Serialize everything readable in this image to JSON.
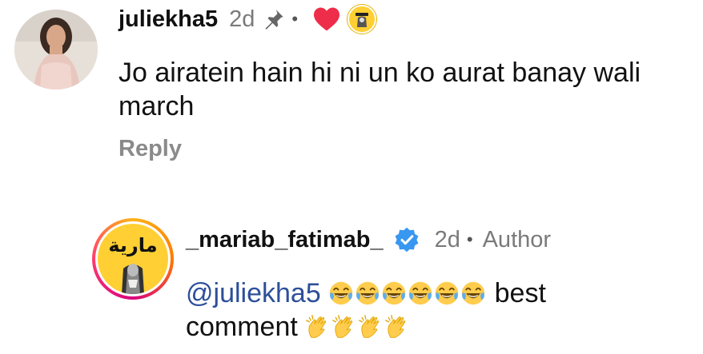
{
  "comments": [
    {
      "username": "juliekha5",
      "age": "2d",
      "body": "Jo airatein hain hi ni un ko aurat banay wali march",
      "reply_label": "Reply",
      "icons": [
        "pin-icon",
        "heart-icon",
        "creator-liked-badge"
      ]
    },
    {
      "username": "_mariab_fatimab_",
      "age": "2d",
      "author_label": "Author",
      "mention": "@juliekha5",
      "text_after_laugh": "best",
      "text_line2": "comment",
      "avatar_text": "مارية",
      "icons": [
        "verified-icon",
        "laughing-emoji",
        "clapping-emoji"
      ]
    }
  ],
  "colors": {
    "username": "#111111",
    "meta": "#7a7a7a",
    "mention": "#2d4f9a",
    "heart": "#ed2d49",
    "verified": "#3897f0",
    "badge_yellow": "#ffcf33"
  },
  "separator_dot": "•"
}
